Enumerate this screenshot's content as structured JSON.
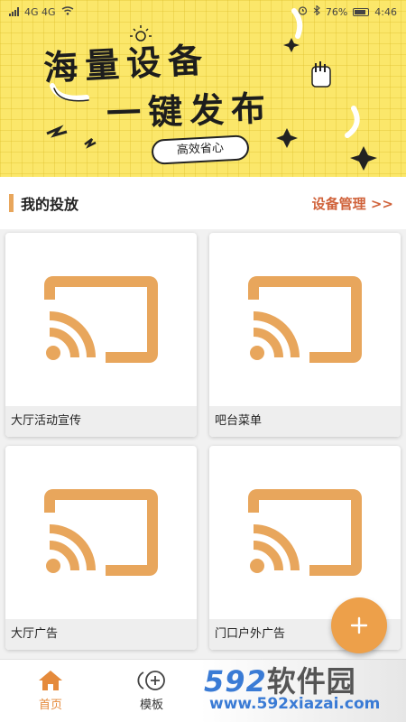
{
  "status_bar": {
    "left": "4G 4G",
    "battery": "76%",
    "time": "4:46"
  },
  "banner": {
    "line1": "海量设备",
    "line2": "一键发布",
    "tagline": "高效省心"
  },
  "section": {
    "title": "我的投放",
    "link": "设备管理 >>"
  },
  "cards": [
    {
      "label": "大厅活动宣传",
      "icon": "cast-icon"
    },
    {
      "label": "吧台菜单",
      "icon": "cast-icon"
    },
    {
      "label": "大厅广告",
      "icon": "cast-icon"
    },
    {
      "label": "门口户外广告",
      "icon": "cast-icon"
    }
  ],
  "fab": {
    "icon": "plus-icon",
    "symbol": "+"
  },
  "bottom_nav": [
    {
      "label": "首页",
      "icon": "home-icon",
      "active": true
    },
    {
      "label": "模板",
      "icon": "template-icon",
      "active": false
    }
  ],
  "watermark": {
    "brand_num": "592",
    "brand_cn": "软件园",
    "url": "www.592xiazai.com"
  },
  "colors": {
    "accent": "#e8a65c",
    "link": "#d0623a",
    "banner_bg": "#fbe76a",
    "nav_active": "#e58a3b"
  }
}
